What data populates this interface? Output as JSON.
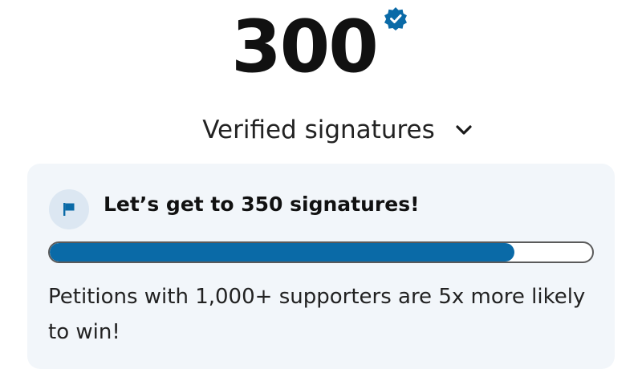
{
  "signature_count": "300",
  "verified_label": "Verified signatures",
  "goal": {
    "title": "Let’s get to 350 signatures!",
    "progress_fraction": 0.857
  },
  "info_text": "Petitions with 1,000+ supporters are 5x more likely to win!",
  "icons": {
    "badge": "verified-check-badge-icon",
    "toggle": "chevron-down-icon",
    "goal": "flag-icon"
  },
  "colors": {
    "accent": "#0a6aa7",
    "card_background": "#f2f6fa",
    "flag_circle": "#dce7f2"
  }
}
